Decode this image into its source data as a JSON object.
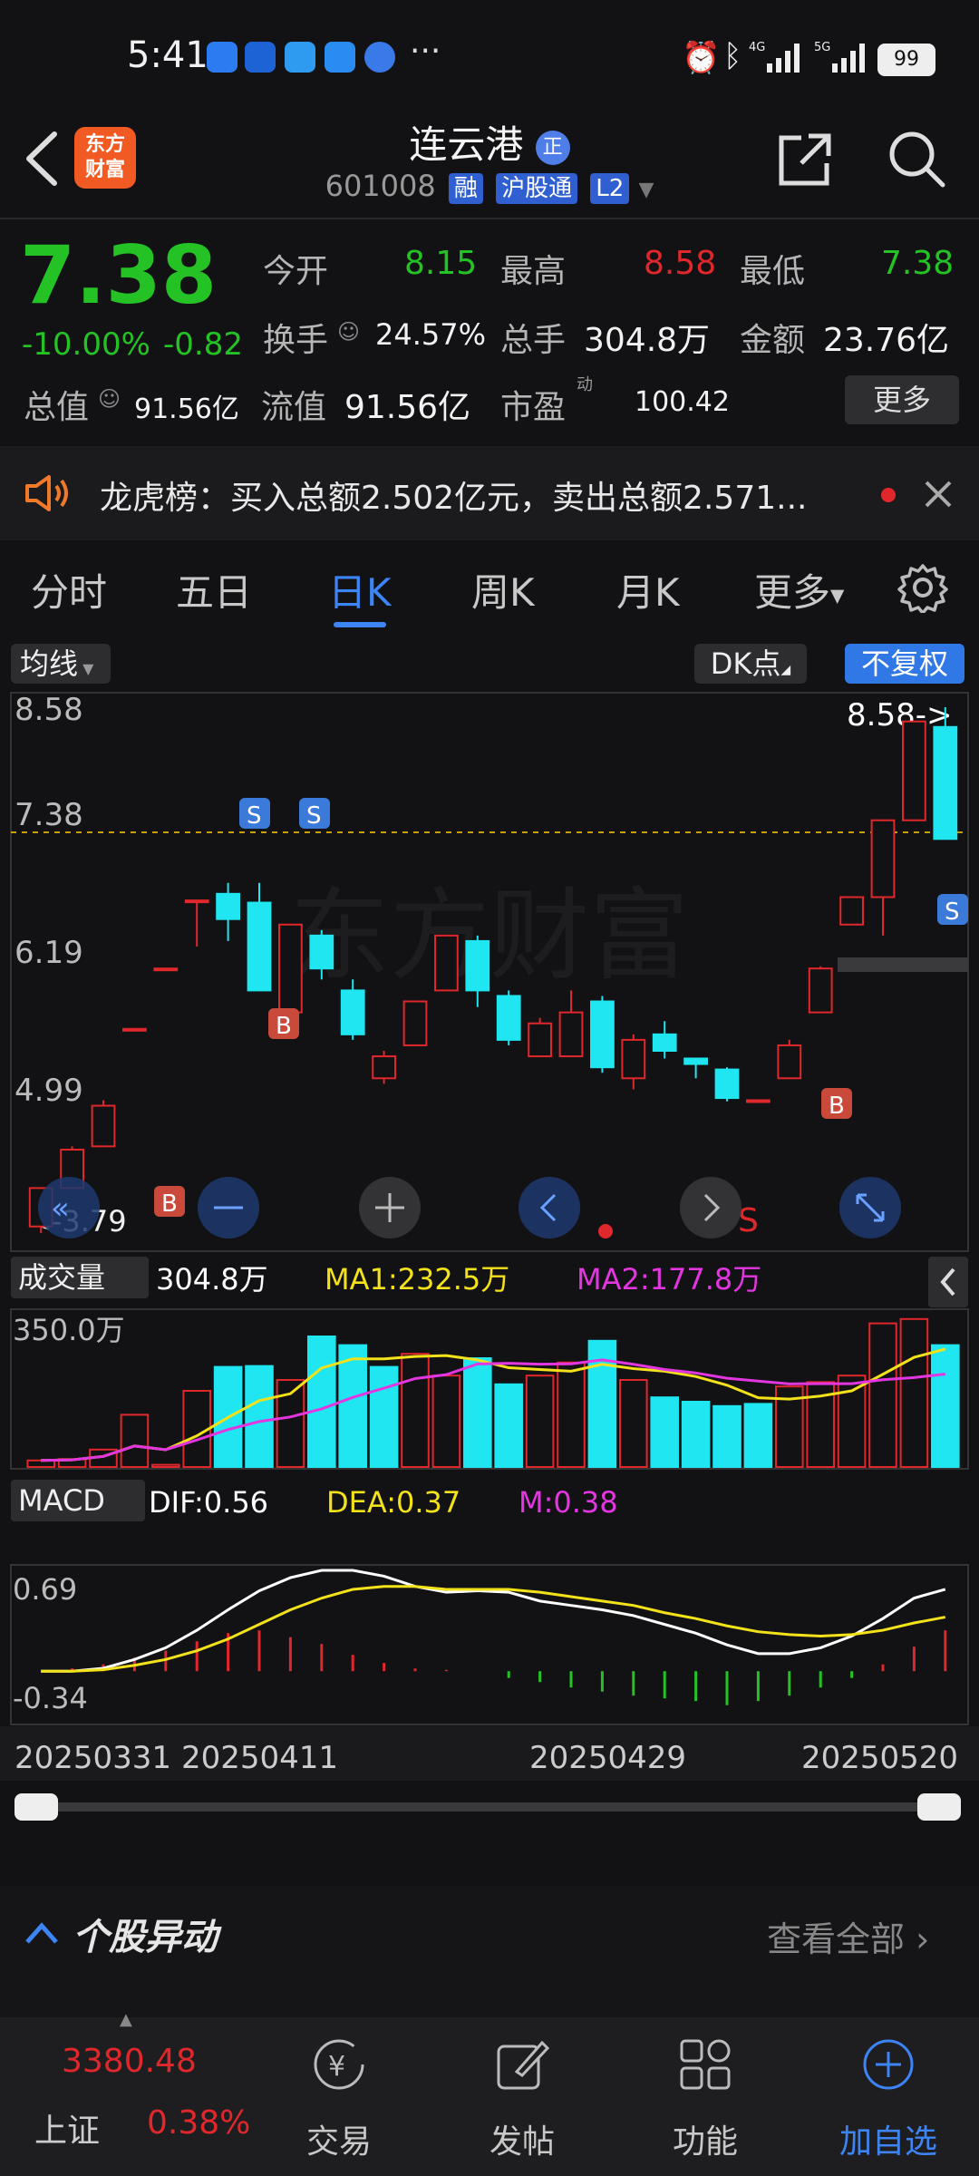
{
  "status_bar": {
    "time": "5:41",
    "dots": "···",
    "battery": "99"
  },
  "header": {
    "title": "连云港",
    "badge": "正",
    "code": "601008",
    "tags": [
      "融",
      "沪股通",
      "L2"
    ],
    "logo_text": "东方\n财富"
  },
  "quote": {
    "price": "7.38",
    "change_pct": "-10.00%",
    "change": "-0.82",
    "open_label": "今开",
    "open": "8.15",
    "high_label": "最高",
    "high": "8.58",
    "low_label": "最低",
    "low": "7.38",
    "turnover_label": "换手",
    "turnover": "24.57%",
    "volume_label": "总手",
    "volume": "304.8万",
    "amount_label": "金额",
    "amount": "23.76亿",
    "total_cap_label": "总值",
    "total_cap": "91.56亿",
    "float_cap_label": "流值",
    "float_cap": "91.56亿",
    "pe_label": "市盈",
    "pe_sup": "动",
    "pe": "100.42",
    "more_label": "更多"
  },
  "dragon_tiger": {
    "text": "龙虎榜：买入总额2.502亿元，卖出总额2.571..."
  },
  "tabs": {
    "items": [
      "分时",
      "五日",
      "日K",
      "周K",
      "月K",
      "更多"
    ],
    "active": "日K"
  },
  "chart_toolbar": {
    "ma_label": "均线",
    "dk_label": "DK点",
    "fq_label": "不复权"
  },
  "kline": {
    "y_labels": [
      "8.58",
      "7.38",
      "6.19",
      "4.99"
    ],
    "bottom_left": "<-3.79",
    "max_marker": "8.58->",
    "watermark": "东方财富"
  },
  "volume_panel": {
    "label": "成交量",
    "vol": "304.8万",
    "ma1": "MA1:232.5万",
    "ma2": "MA2:177.8万",
    "y_label": "350.0万"
  },
  "macd_panel": {
    "label": "MACD",
    "dif": "DIF:0.56",
    "dea": "DEA:0.37",
    "m": "M:0.38",
    "y_top": "0.69",
    "y_bottom": "-0.34"
  },
  "dates": [
    "20250331",
    "20250411",
    "20250429",
    "20250520"
  ],
  "section": {
    "title": "个股异动",
    "view_all": "查看全部"
  },
  "bottom_nav": {
    "index_value": "3380.48",
    "index_name": "上证",
    "index_pct": "0.38%",
    "items": [
      "交易",
      "发帖",
      "功能",
      "加自选"
    ]
  },
  "chart_data": {
    "type": "candlestick",
    "candles": [
      {
        "o": 3.85,
        "c": 4.2,
        "h": 4.2,
        "l": 3.79
      },
      {
        "o": 4.2,
        "c": 4.55,
        "h": 4.58,
        "l": 4.2
      },
      {
        "o": 4.58,
        "c": 4.95,
        "h": 5.0,
        "l": 4.58
      },
      {
        "o": 5.65,
        "c": 5.65,
        "h": 5.65,
        "l": 5.65
      },
      {
        "o": 6.2,
        "c": 6.2,
        "h": 6.2,
        "l": 6.2
      },
      {
        "o": 6.82,
        "c": 6.82,
        "h": 6.82,
        "l": 6.4
      },
      {
        "o": 6.88,
        "c": 6.65,
        "h": 6.98,
        "l": 6.45
      },
      {
        "o": 6.8,
        "c": 6.0,
        "h": 6.98,
        "l": 6.0
      },
      {
        "o": 5.8,
        "c": 6.6,
        "h": 6.6,
        "l": 5.8
      },
      {
        "o": 6.5,
        "c": 6.2,
        "h": 6.55,
        "l": 6.1
      },
      {
        "o": 6.0,
        "c": 5.6,
        "h": 6.1,
        "l": 5.55
      },
      {
        "o": 5.2,
        "c": 5.4,
        "h": 5.45,
        "l": 5.15
      },
      {
        "o": 5.5,
        "c": 5.9,
        "h": 5.9,
        "l": 5.5
      },
      {
        "o": 6.0,
        "c": 6.5,
        "h": 6.5,
        "l": 6.0
      },
      {
        "o": 6.45,
        "c": 6.0,
        "h": 6.5,
        "l": 5.85
      },
      {
        "o": 5.95,
        "c": 5.55,
        "h": 6.0,
        "l": 5.5
      },
      {
        "o": 5.4,
        "c": 5.7,
        "h": 5.75,
        "l": 5.4
      },
      {
        "o": 5.4,
        "c": 5.8,
        "h": 6.0,
        "l": 5.4
      },
      {
        "o": 5.9,
        "c": 5.3,
        "h": 5.95,
        "l": 5.25
      },
      {
        "o": 5.2,
        "c": 5.55,
        "h": 5.6,
        "l": 5.1
      },
      {
        "o": 5.6,
        "c": 5.45,
        "h": 5.72,
        "l": 5.38
      },
      {
        "o": 5.38,
        "c": 5.33,
        "h": 5.38,
        "l": 5.2
      },
      {
        "o": 5.28,
        "c": 5.02,
        "h": 5.3,
        "l": 4.99
      },
      {
        "o": 5.0,
        "c": 5.0,
        "h": 5.0,
        "l": 4.98
      },
      {
        "o": 5.2,
        "c": 5.5,
        "h": 5.55,
        "l": 5.2
      },
      {
        "o": 5.8,
        "c": 6.2,
        "h": 6.22,
        "l": 5.8
      },
      {
        "o": 6.6,
        "c": 6.85,
        "h": 6.85,
        "l": 6.6
      },
      {
        "o": 6.85,
        "c": 7.55,
        "h": 7.55,
        "l": 6.5
      },
      {
        "o": 7.55,
        "c": 8.45,
        "h": 8.45,
        "l": 7.55
      },
      {
        "o": 8.4,
        "c": 7.38,
        "h": 8.58,
        "l": 7.38
      }
    ],
    "volume": [
      15,
      18,
      40,
      120,
      5,
      175,
      230,
      232,
      200,
      300,
      280,
      230,
      260,
      210,
      250,
      190,
      210,
      240,
      290,
      200,
      160,
      150,
      140,
      145,
      185,
      195,
      210,
      330,
      340,
      280
    ],
    "volume_up": [
      true,
      true,
      true,
      true,
      true,
      true,
      false,
      false,
      true,
      false,
      false,
      false,
      true,
      true,
      false,
      false,
      true,
      true,
      false,
      true,
      false,
      false,
      false,
      false,
      true,
      true,
      true,
      true,
      true,
      false
    ],
    "macd_hist": [
      0,
      0.02,
      0.05,
      0.1,
      0.15,
      0.22,
      0.28,
      0.3,
      0.25,
      0.2,
      0.12,
      0.06,
      0.02,
      0.01,
      0,
      -0.05,
      -0.08,
      -0.12,
      -0.15,
      -0.18,
      -0.2,
      -0.22,
      -0.25,
      -0.22,
      -0.18,
      -0.12,
      -0.05,
      0.05,
      0.18,
      0.3
    ],
    "y_range": [
      3.79,
      8.58
    ]
  }
}
